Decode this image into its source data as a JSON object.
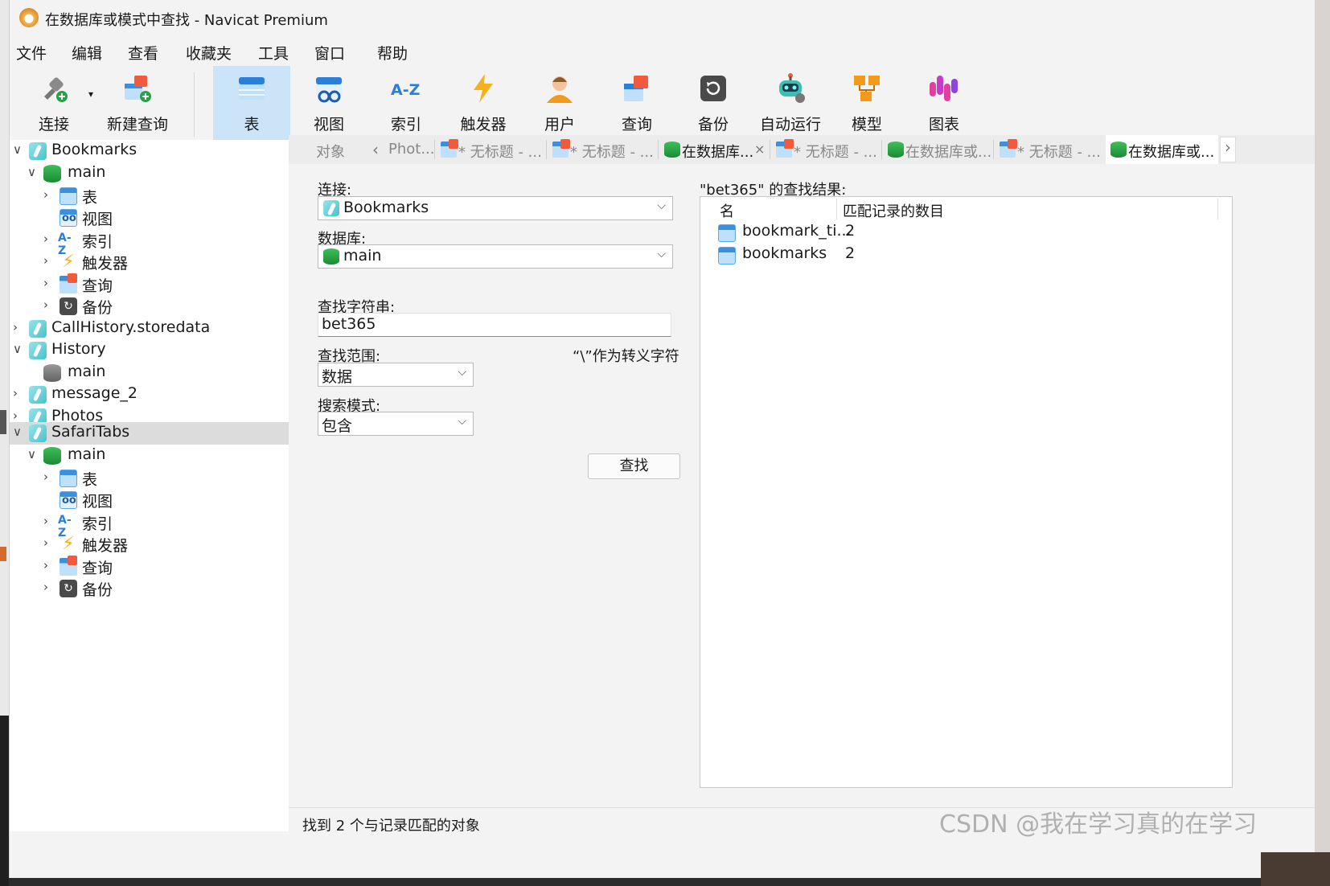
{
  "window": {
    "title": "在数据库或模式中查找 - Navicat Premium"
  },
  "menu": [
    "文件",
    "编辑",
    "查看",
    "收藏夹",
    "工具",
    "窗口",
    "帮助"
  ],
  "toolbar": {
    "items": [
      {
        "label": "连接",
        "icon": "connect-icon"
      },
      {
        "label": "新建查询",
        "icon": "new-query-icon"
      },
      {
        "label": "表",
        "icon": "table-icon",
        "active": true
      },
      {
        "label": "视图",
        "icon": "view-icon"
      },
      {
        "label": "索引",
        "icon": "index-icon"
      },
      {
        "label": "触发器",
        "icon": "trigger-icon"
      },
      {
        "label": "用户",
        "icon": "user-icon"
      },
      {
        "label": "查询",
        "icon": "query-icon"
      },
      {
        "label": "备份",
        "icon": "backup-icon"
      },
      {
        "label": "自动运行",
        "icon": "robot-icon"
      },
      {
        "label": "模型",
        "icon": "model-icon"
      },
      {
        "label": "图表",
        "icon": "chart-icon"
      }
    ]
  },
  "tree": {
    "items": [
      {
        "label": "Bookmarks",
        "type": "connection",
        "expanded": true
      },
      {
        "label": "main",
        "type": "database",
        "expanded": true
      },
      {
        "label": "表",
        "type": "tables"
      },
      {
        "label": "视图",
        "type": "views"
      },
      {
        "label": "索引",
        "type": "indexes"
      },
      {
        "label": "触发器",
        "type": "triggers"
      },
      {
        "label": "查询",
        "type": "queries"
      },
      {
        "label": "备份",
        "type": "backups"
      },
      {
        "label": "CallHistory.storedata",
        "type": "connection"
      },
      {
        "label": "History",
        "type": "connection",
        "expanded": true
      },
      {
        "label": "main",
        "type": "database-closed"
      },
      {
        "label": "message_2",
        "type": "connection"
      },
      {
        "label": "Photos",
        "type": "connection"
      },
      {
        "label": "SafariTabs",
        "type": "connection",
        "expanded": true,
        "selected": true
      },
      {
        "label": "main",
        "type": "database",
        "expanded": true
      },
      {
        "label": "表",
        "type": "tables"
      },
      {
        "label": "视图",
        "type": "views"
      },
      {
        "label": "索引",
        "type": "indexes"
      },
      {
        "label": "触发器",
        "type": "triggers"
      },
      {
        "label": "查询",
        "type": "queries"
      },
      {
        "label": "备份",
        "type": "backups"
      }
    ],
    "index_icon_text": "A-Z"
  },
  "tabs": {
    "objects": "对象",
    "items": [
      {
        "label": "Phot..."
      },
      {
        "label": "* 无标题 - ..."
      },
      {
        "label": "* 无标题 - ..."
      },
      {
        "label": "在数据库...",
        "close": "×"
      },
      {
        "label": "* 无标题 - ..."
      },
      {
        "label": "在数据库或..."
      },
      {
        "label": "* 无标题 - ..."
      },
      {
        "label": "在数据库或...",
        "active": true
      }
    ]
  },
  "form": {
    "connection_label": "连接:",
    "connection_value": "Bookmarks",
    "database_label": "数据库:",
    "database_value": "main",
    "search_label": "查找字符串:",
    "search_value": "bet365",
    "scope_label": "查找范围:",
    "escape_note": "“\\”作为转义字符",
    "scope_value": "数据",
    "mode_label": "搜索模式:",
    "mode_value": "包含",
    "find_button": "查找"
  },
  "results": {
    "title": "\"bet365\" 的查找结果:",
    "columns": [
      "名",
      "匹配记录的数目"
    ],
    "rows": [
      {
        "name": "bookmark_ti...",
        "count": "2"
      },
      {
        "name": "bookmarks",
        "count": "2"
      }
    ]
  },
  "status": {
    "text": "找到 2 个与记录匹配的对象"
  },
  "watermark": "CSDN @我在学习真的在学习",
  "colors": {
    "accent": "#cce4f7",
    "selected_row": "#dcdcdc",
    "db_green": "#2aa147"
  }
}
